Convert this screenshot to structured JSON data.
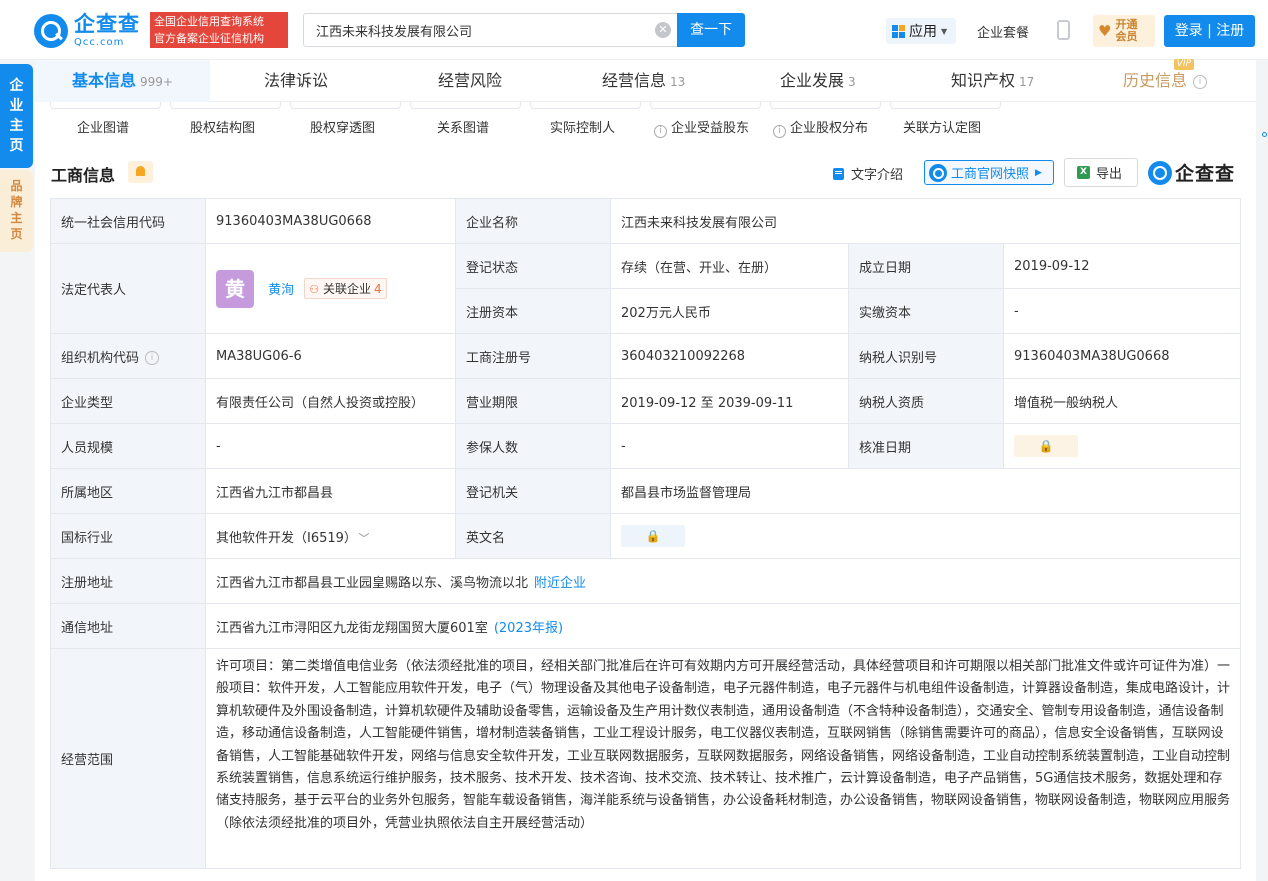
{
  "header": {
    "logo_text": "企查查",
    "logo_sub": "Qcc.com",
    "slogan_line1": "全国企业信用查询系统",
    "slogan_line2": "官方备案企业征信机构",
    "search_value": "江西未来科技发展有限公司",
    "search_button": "查一下",
    "app_menu": "应用",
    "package_link": "企业套餐",
    "vip_line1": "开通",
    "vip_line2": "会员",
    "login_button": "登录 | 注册"
  },
  "side_tabs": {
    "company_home": [
      "企",
      "业",
      "主",
      "页"
    ],
    "brand_home": [
      "品",
      "牌",
      "主",
      "页"
    ]
  },
  "tabs": [
    {
      "label": "基本信息",
      "count": "999+"
    },
    {
      "label": "法律诉讼",
      "count": ""
    },
    {
      "label": "经营风险",
      "count": ""
    },
    {
      "label": "经营信息",
      "count": "13"
    },
    {
      "label": "企业发展",
      "count": "3"
    },
    {
      "label": "知识产权",
      "count": "17"
    },
    {
      "label": "历史信息",
      "count": "",
      "badge": "VIP"
    }
  ],
  "subnav": [
    "企业图谱",
    "股权结构图",
    "股权穿透图",
    "关系图谱",
    "实际控制人",
    "企业受益股东",
    "企业股权分布",
    "关联方认定图"
  ],
  "section": {
    "title": "工商信息",
    "text_intro": "文字介绍",
    "snapshot": "工商官网快照",
    "export": "导出",
    "brand": "企查查"
  },
  "business": {
    "credit_code_label": "统一社会信用代码",
    "credit_code": "91360403MA38UG0668",
    "company_name_label": "企业名称",
    "company_name": "江西未来科技发展有限公司",
    "legal_rep_label": "法定代表人",
    "legal_rep_avatar": "黄",
    "legal_rep_name": "黄洵",
    "related_label": "关联企业",
    "related_count": "4",
    "status_label": "登记状态",
    "status": "存续（在营、开业、在册）",
    "founded_label": "成立日期",
    "founded": "2019-09-12",
    "capital_label": "注册资本",
    "capital": "202万元人民币",
    "paid_capital_label": "实缴资本",
    "paid_capital": "-",
    "org_code_label": "组织机构代码",
    "org_code": "MA38UG06-6",
    "reg_no_label": "工商注册号",
    "reg_no": "360403210092268",
    "taxpayer_id_label": "纳税人识别号",
    "taxpayer_id": "91360403MA38UG0668",
    "type_label": "企业类型",
    "type": "有限责任公司（自然人投资或控股）",
    "term_label": "营业期限",
    "term": "2019-09-12 至 2039-09-11",
    "taxpayer_qual_label": "纳税人资质",
    "taxpayer_qual": "增值税一般纳税人",
    "staff_label": "人员规模",
    "staff": "-",
    "insured_label": "参保人数",
    "insured": "-",
    "approve_label": "核准日期",
    "region_label": "所属地区",
    "region": "江西省九江市都昌县",
    "authority_label": "登记机关",
    "authority": "都昌县市场监督管理局",
    "industry_label": "国标行业",
    "industry": "其他软件开发（I6519）",
    "english_label": "英文名",
    "address_label": "注册地址",
    "address": "江西省九江市都昌县工业园皇赐路以东、溪鸟物流以北",
    "nearby": "附近企业",
    "contact_label": "通信地址",
    "contact_address": "江西省九江市浔阳区九龙街龙翔国贸大厦601室",
    "report_year": "(2023年报)",
    "scope_label": "经营范围",
    "scope": "许可项目：第二类增值电信业务（依法须经批准的项目，经相关部门批准后在许可有效期内方可开展经营活动，具体经营项目和许可期限以相关部门批准文件或许可证件为准）一般项目：软件开发，人工智能应用软件开发，电子（气）物理设备及其他电子设备制造，电子元器件制造，电子元器件与机电组件设备制造，计算器设备制造，集成电路设计，计算机软硬件及外围设备制造，计算机软硬件及辅助设备零售，运输设备及生产用计数仪表制造，通用设备制造（不含特种设备制造），交通安全、管制专用设备制造，通信设备制造，移动通信设备制造，人工智能硬件销售，增材制造装备销售，工业工程设计服务，电工仪器仪表制造，互联网销售（除销售需要许可的商品），信息安全设备销售，互联网设备销售，人工智能基础软件开发，网络与信息安全软件开发，工业互联网数据服务，互联网数据服务，网络设备销售，网络设备制造，工业自动控制系统装置制造，工业自动控制系统装置销售，信息系统运行维护服务，技术服务、技术开发、技术咨询、技术交流、技术转让、技术推广，云计算设备制造，电子产品销售，5G通信技术服务，数据处理和存储支持服务，基于云平台的业务外包服务，智能车载设备销售，海洋能系统与设备销售，办公设备耗材制造，办公设备销售，物联网设备销售，物联网设备制造，物联网应用服务（除依法须经批准的项目外，凭营业执照依法自主开展经营活动）"
  }
}
